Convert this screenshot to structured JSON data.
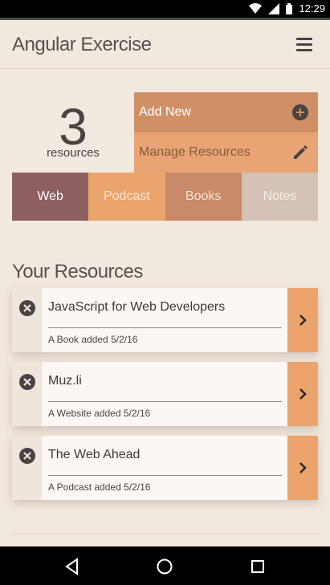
{
  "status_bar": {
    "time": "12:29",
    "icons": [
      "wifi-icon",
      "signal-icon",
      "battery-icon"
    ]
  },
  "header": {
    "title": "Angular Exercise",
    "menu_icon": "hamburger-menu-icon"
  },
  "summary": {
    "count": "3",
    "label": "resources"
  },
  "actions": {
    "add_new": "Add New",
    "add_icon": "plus-circle-icon",
    "manage": "Manage Resources",
    "manage_icon": "pencil-icon"
  },
  "tabs": [
    {
      "label": "Web",
      "color": "#8c6060"
    },
    {
      "label": "Podcast",
      "color": "#eba46b"
    },
    {
      "label": "Books",
      "color": "#c88a68"
    },
    {
      "label": "Notes",
      "color": "#d3c2b5"
    }
  ],
  "resources": {
    "section_title": "Your Resources",
    "items": [
      {
        "title": "JavaScript for Web Developers",
        "meta": "A Book added 5/2/16"
      },
      {
        "title": "Muz.li",
        "meta": "A Website added 5/2/16"
      },
      {
        "title": "The Web Ahead",
        "meta": "A Podcast added 5/2/16"
      }
    ]
  },
  "nav": {
    "icons": [
      "back-triangle-icon",
      "home-circle-icon",
      "recents-square-icon"
    ]
  },
  "colors": {
    "background": "#f1e9df",
    "accent_orange": "#eba46b",
    "accent_brown": "#8c6060"
  }
}
